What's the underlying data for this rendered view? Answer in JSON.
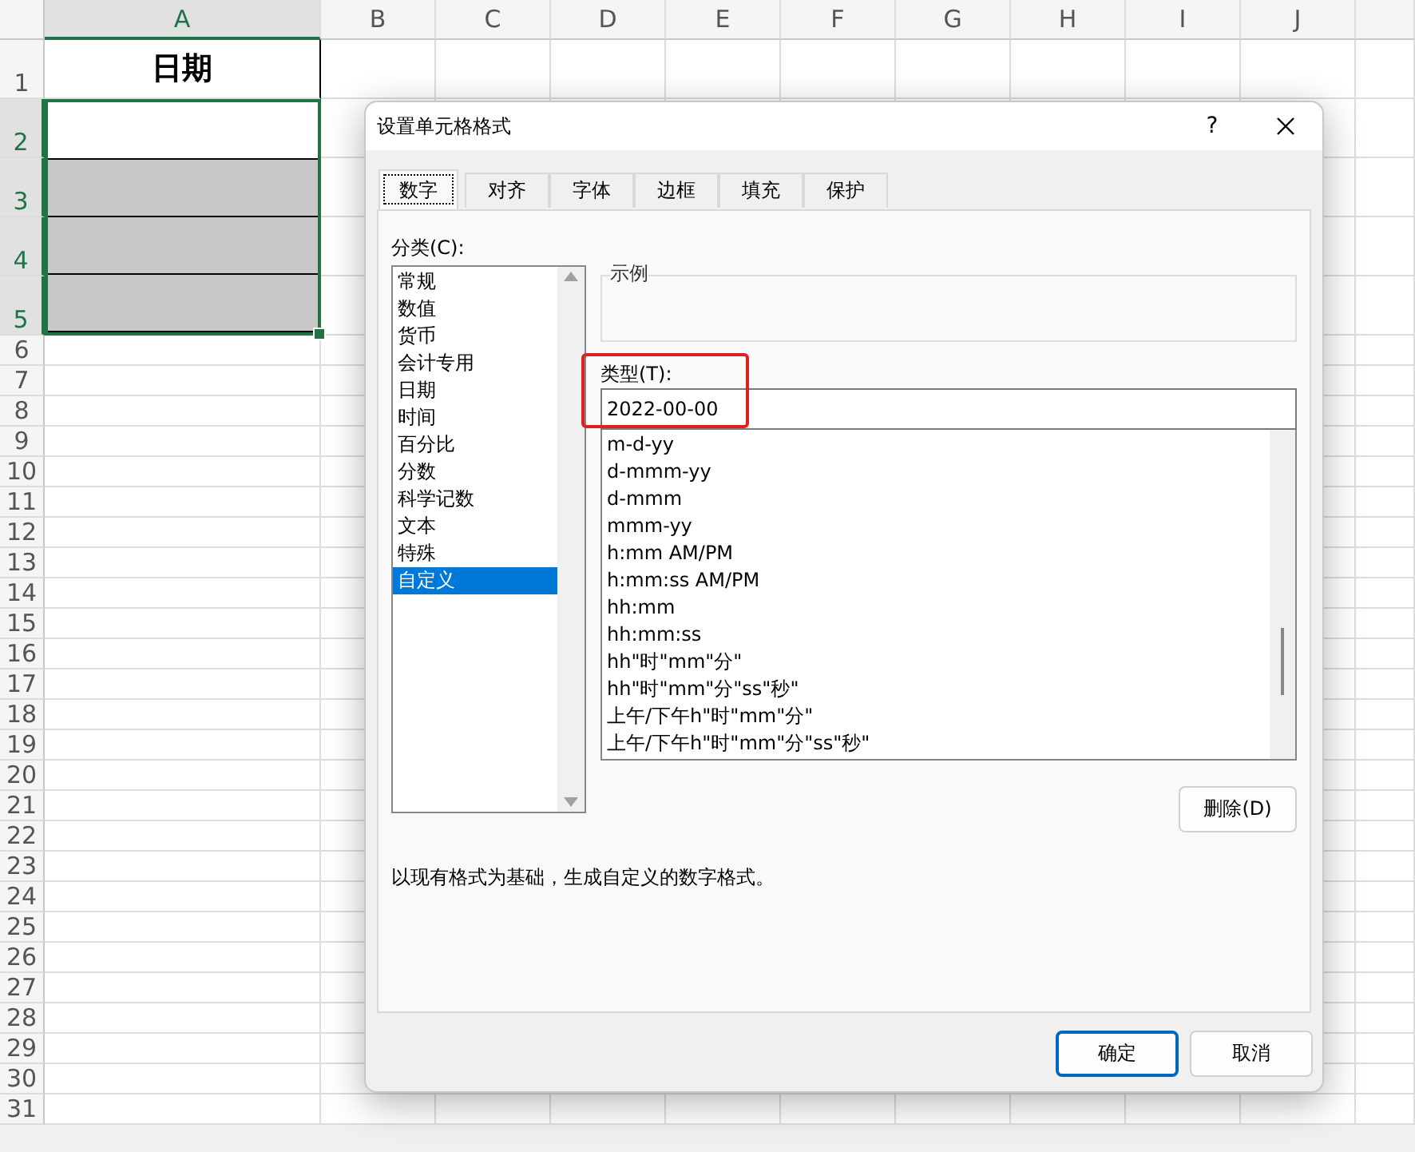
{
  "sheet": {
    "columns": [
      "A",
      "B",
      "C",
      "D",
      "E",
      "F",
      "G",
      "H",
      "I",
      "J"
    ],
    "rows": [
      "1",
      "2",
      "3",
      "4",
      "5",
      "6",
      "7",
      "8",
      "9",
      "10",
      "11",
      "12",
      "13",
      "14",
      "15",
      "16",
      "17",
      "18",
      "19",
      "20",
      "21",
      "22",
      "23",
      "24",
      "25",
      "26",
      "27",
      "28",
      "29",
      "30",
      "31"
    ],
    "header_cell": "日期",
    "cells": [
      {
        "filled": false
      },
      {
        "filled": true
      },
      {
        "filled": true
      },
      {
        "filled": true
      }
    ]
  },
  "dialog": {
    "title": "设置单元格格式",
    "help": "?",
    "tabs": [
      {
        "label": "数字",
        "selected": true
      },
      {
        "label": "对齐",
        "selected": false
      },
      {
        "label": "字体",
        "selected": false
      },
      {
        "label": "边框",
        "selected": false
      },
      {
        "label": "填充",
        "selected": false
      },
      {
        "label": "保护",
        "selected": false
      }
    ],
    "category_label": "分类(C):",
    "categories": [
      {
        "label": "常规",
        "selected": false
      },
      {
        "label": "数值",
        "selected": false
      },
      {
        "label": "货币",
        "selected": false
      },
      {
        "label": "会计专用",
        "selected": false
      },
      {
        "label": "日期",
        "selected": false
      },
      {
        "label": "时间",
        "selected": false
      },
      {
        "label": "百分比",
        "selected": false
      },
      {
        "label": "分数",
        "selected": false
      },
      {
        "label": "科学记数",
        "selected": false
      },
      {
        "label": "文本",
        "selected": false
      },
      {
        "label": "特殊",
        "selected": false
      },
      {
        "label": "自定义",
        "selected": true
      }
    ],
    "sample_label": "示例",
    "type_label": "类型(T):",
    "type_value": "2022-00-00",
    "formats": [
      "m-d-yy",
      "d-mmm-yy",
      "d-mmm",
      "mmm-yy",
      "h:mm AM/PM",
      "h:mm:ss AM/PM",
      "hh:mm",
      "hh:mm:ss",
      "hh\"时\"mm\"分\"",
      "hh\"时\"mm\"分\"ss\"秒\"",
      "上午/下午h\"时\"mm\"分\"",
      "上午/下午h\"时\"mm\"分\"ss\"秒\""
    ],
    "delete_button": "删除(D)",
    "description": "以现有格式为基础，生成自定义的数字格式。",
    "ok_button": "确定",
    "cancel_button": "取消"
  }
}
